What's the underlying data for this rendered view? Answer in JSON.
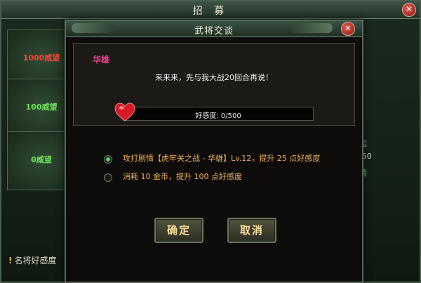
{
  "outer_window": {
    "title": "招 募",
    "close": "✕",
    "panels": [
      {
        "label": "1000威望"
      },
      {
        "label": "100威望"
      },
      {
        "label": "0威望"
      }
    ],
    "right_text_1": "志",
    "right_text_2": "/50",
    "right_text_3": "请",
    "hint": "名将好感度"
  },
  "dialog": {
    "title": "武将交谈",
    "close": "✕",
    "npc_name": "华雄",
    "npc_line": "来来来，先与我大战20回合再说！",
    "favor": {
      "label": "好感度: 0/500",
      "current": 0,
      "max": 500
    },
    "options": [
      {
        "text": "攻打剧情【虎牢关之战 - 华雄】Lv.12，提升 25 点好感度",
        "selected": true
      },
      {
        "text": "消耗 10 金币，提升 100 点好感度",
        "selected": false
      }
    ],
    "buttons": {
      "confirm": "确定",
      "cancel": "取消"
    }
  },
  "colors": {
    "npc_name": "#ec3f96",
    "option_text": "#f1b25a",
    "selected_radio": "#58d56d"
  },
  "icons": {
    "favor": "heart-icon",
    "close": "close-icon"
  }
}
